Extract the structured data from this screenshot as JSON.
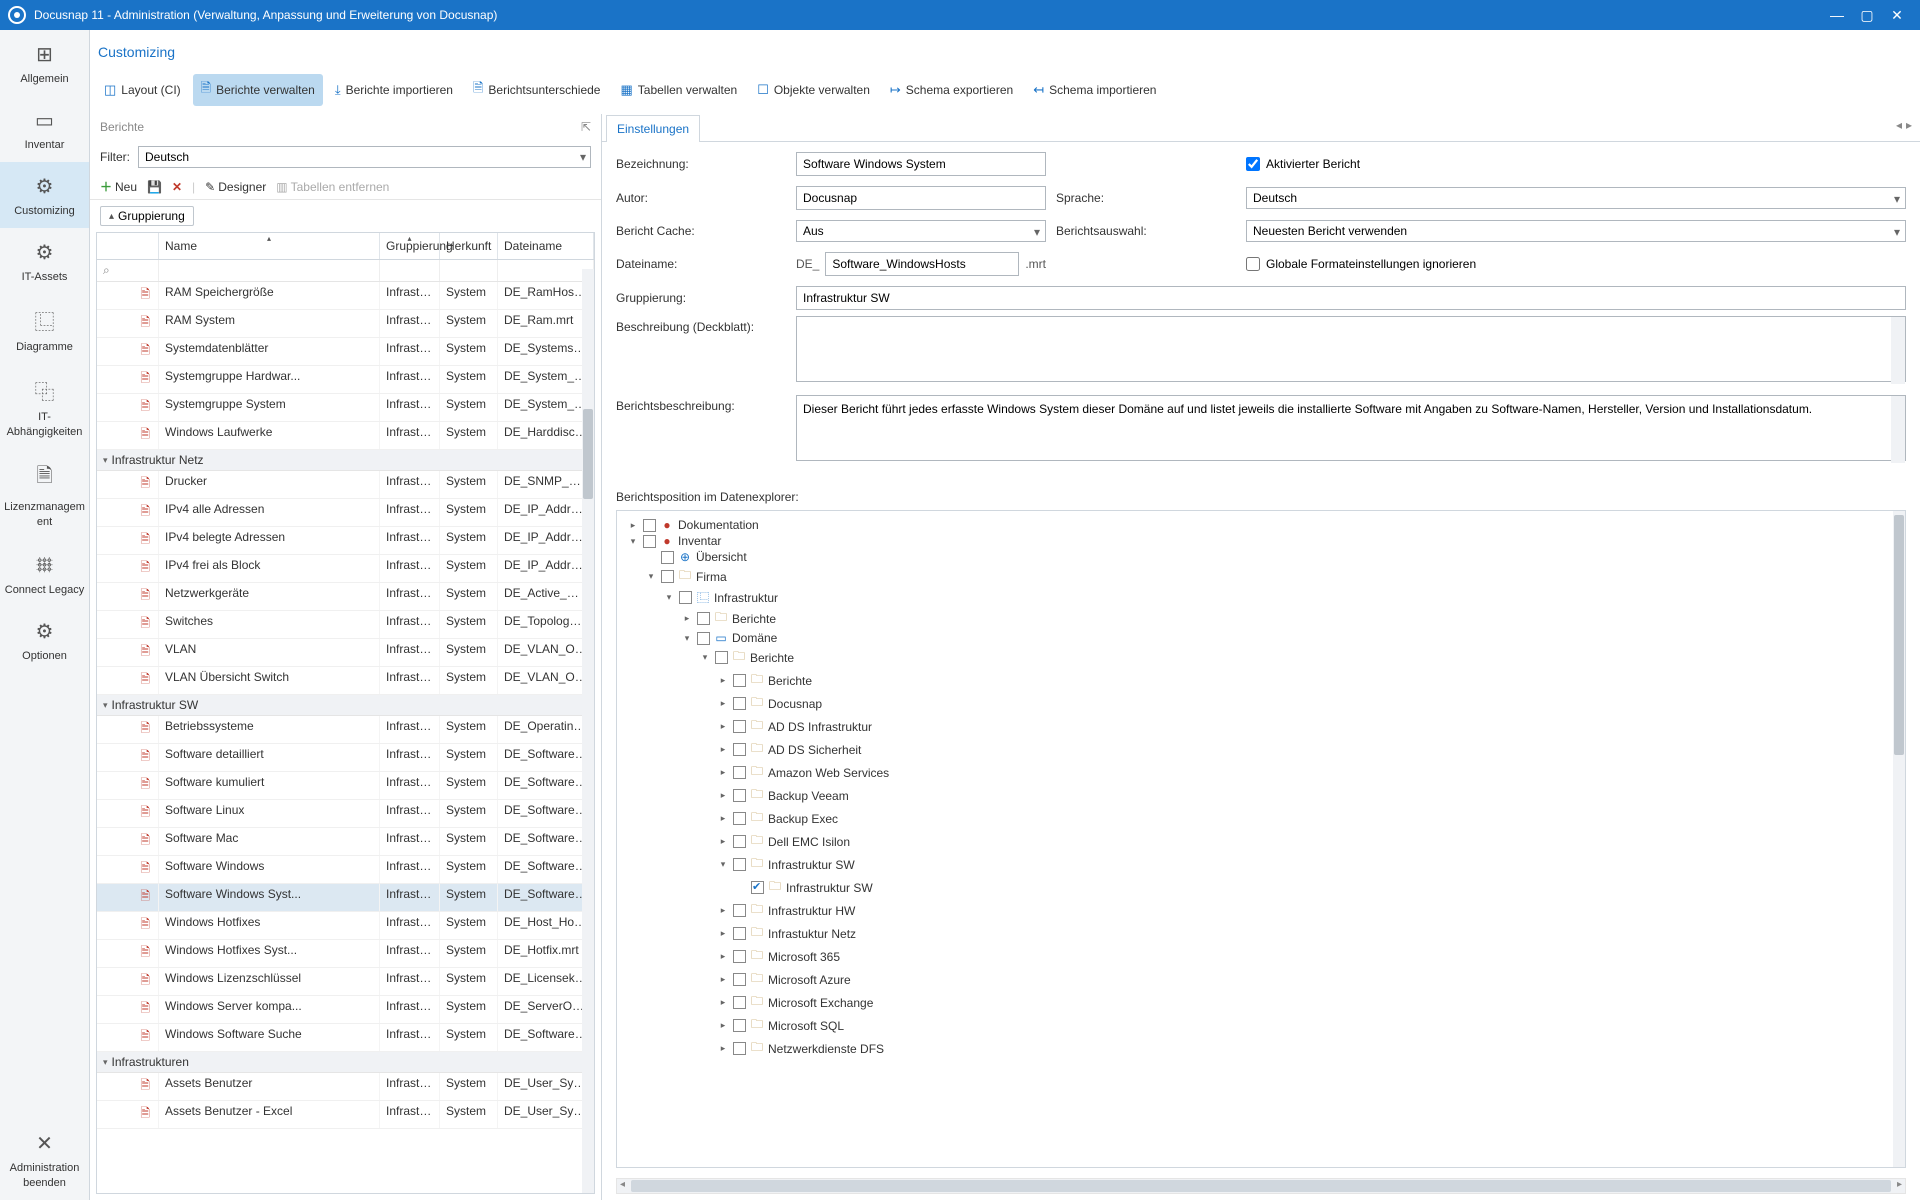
{
  "titlebar": {
    "text": "Docusnap 11 - Administration (Verwaltung, Anpassung und Erweiterung von Docusnap)"
  },
  "sidebar": {
    "items": [
      {
        "label": "Allgemein",
        "icon": "⊞"
      },
      {
        "label": "Inventar",
        "icon": "▭"
      },
      {
        "label": "Customizing",
        "icon": "⚙"
      },
      {
        "label": "IT-Assets",
        "icon": "⚙"
      },
      {
        "label": "Diagramme",
        "icon": "⿺"
      },
      {
        "label": "IT-Abhängigkeiten",
        "icon": "⿻"
      },
      {
        "label": "Lizenzmanagement",
        "icon": "🗎"
      },
      {
        "label": "Connect Legacy",
        "icon": "𐄳"
      },
      {
        "label": "Optionen",
        "icon": "⚙"
      }
    ],
    "exit": {
      "label": "Administration beenden",
      "icon": "✕"
    }
  },
  "page": {
    "title": "Customizing"
  },
  "toolbar": {
    "items": [
      {
        "label": "Layout (CI)",
        "icon": "◫"
      },
      {
        "label": "Berichte verwalten",
        "icon": "🗎"
      },
      {
        "label": "Berichte importieren",
        "icon": "⤓"
      },
      {
        "label": "Berichtsunterschiede",
        "icon": "🗎"
      },
      {
        "label": "Tabellen verwalten",
        "icon": "▦"
      },
      {
        "label": "Objekte verwalten",
        "icon": "☐"
      },
      {
        "label": "Schema exportieren",
        "icon": "↦"
      },
      {
        "label": "Schema importieren",
        "icon": "↤"
      }
    ]
  },
  "leftPane": {
    "header": "Berichte",
    "filter_label": "Filter:",
    "filter_value": "Deutsch",
    "actions": {
      "neu": "Neu",
      "designer": "Designer",
      "remove": "Tabellen entfernen"
    },
    "group_chip": "Gruppierung",
    "columns": {
      "name": "Name",
      "grp": "Gruppierung",
      "her": "Herkunft",
      "file": "Dateiname"
    },
    "groups": [
      {
        "name": "",
        "rows": [
          {
            "name": "RAM Speichergröße",
            "grp": "Infrastruk...",
            "her": "System",
            "file": "DE_RamHosts.mrt"
          },
          {
            "name": "RAM System",
            "grp": "Infrastruk...",
            "her": "System",
            "file": "DE_Ram.mrt"
          },
          {
            "name": "Systemdatenblätter",
            "grp": "Infrastruk...",
            "her": "System",
            "file": "DE_Systems_Ov..."
          },
          {
            "name": "Systemgruppe Hardwar...",
            "grp": "Infrastruk...",
            "her": "System",
            "file": "DE_System_Gro..."
          },
          {
            "name": "Systemgruppe System",
            "grp": "Infrastruk...",
            "her": "System",
            "file": "DE_System_Gro..."
          },
          {
            "name": "Windows Laufwerke",
            "grp": "Infrastruk...",
            "her": "System",
            "file": "DE_Harddisc.mrt"
          }
        ]
      },
      {
        "name": "Infrastruktur Netz",
        "rows": [
          {
            "name": "Drucker",
            "grp": "Infrastruk...",
            "her": "System",
            "file": "DE_SNMP_Netw..."
          },
          {
            "name": "IPv4 alle Adressen",
            "grp": "Infrastruk...",
            "her": "System",
            "file": "DE_IP_Addresses..."
          },
          {
            "name": "IPv4 belegte Adressen",
            "grp": "Infrastruk...",
            "her": "System",
            "file": "DE_IP_Addresses..."
          },
          {
            "name": "IPv4 frei als Block",
            "grp": "Infrastruk...",
            "her": "System",
            "file": "DE_IP_Addresses..."
          },
          {
            "name": "Netzwerkgeräte",
            "grp": "Infrastruk...",
            "her": "System",
            "file": "DE_Active_Netw..."
          },
          {
            "name": "Switches",
            "grp": "Infrastruk...",
            "her": "System",
            "file": "DE_Topology_Inf..."
          },
          {
            "name": "VLAN",
            "grp": "Infrastruk...",
            "her": "System",
            "file": "DE_VLAN_Overv..."
          },
          {
            "name": "VLAN Übersicht Switch",
            "grp": "Infrastruk...",
            "her": "System",
            "file": "DE_VLAN_Overv..."
          }
        ]
      },
      {
        "name": "Infrastruktur SW",
        "rows": [
          {
            "name": "Betriebssysteme",
            "grp": "Infrastruk...",
            "her": "System",
            "file": "DE_Operating_S..."
          },
          {
            "name": "Software detailliert",
            "grp": "Infrastruk...",
            "her": "System",
            "file": "DE_Software_Su..."
          },
          {
            "name": "Software kumuliert",
            "grp": "Infrastruk...",
            "her": "System",
            "file": "DE_Software_Su..."
          },
          {
            "name": "Software Linux",
            "grp": "Infrastruk...",
            "her": "System",
            "file": "DE_Software_Lin..."
          },
          {
            "name": "Software Mac",
            "grp": "Infrastruk...",
            "her": "System",
            "file": "DE_Software_Ma..."
          },
          {
            "name": "Software Windows",
            "grp": "Infrastruk...",
            "her": "System",
            "file": "DE_Software_Wi..."
          },
          {
            "name": "Software Windows Syst...",
            "grp": "Infrastruk...",
            "her": "System",
            "file": "DE_Software_Wi...",
            "selected": true
          },
          {
            "name": "Windows Hotfixes",
            "grp": "Infrastruk...",
            "her": "System",
            "file": "DE_Host_Hotfix..."
          },
          {
            "name": "Windows Hotfixes Syst...",
            "grp": "Infrastruk...",
            "her": "System",
            "file": "DE_Hotfix.mrt"
          },
          {
            "name": "Windows Lizenzschlüssel",
            "grp": "Infrastruk...",
            "her": "System",
            "file": "DE_Licensekey.mrt"
          },
          {
            "name": "Windows Server kompa...",
            "grp": "Infrastruk...",
            "her": "System",
            "file": "DE_ServerOvervi..."
          },
          {
            "name": "Windows Software Suche",
            "grp": "Infrastruk...",
            "her": "System",
            "file": "DE_Software_Sea..."
          }
        ]
      },
      {
        "name": "Infrastrukturen",
        "rows": [
          {
            "name": "Assets Benutzer",
            "grp": "Infrastruk...",
            "her": "System",
            "file": "DE_User_System..."
          },
          {
            "name": "Assets Benutzer - Excel",
            "grp": "Infrastruk...",
            "her": "System",
            "file": "DE_User_System..."
          }
        ]
      }
    ]
  },
  "settings": {
    "tab": "Einstellungen",
    "labels": {
      "bezeichnung": "Bezeichnung:",
      "aktiv": "Aktivierter Bericht",
      "autor": "Autor:",
      "sprache": "Sprache:",
      "cache": "Bericht Cache:",
      "auswahl": "Berichtsauswahl:",
      "dateiname": "Dateiname:",
      "globale": "Globale Formateinstellungen ignorieren",
      "gruppierung": "Gruppierung:",
      "deckblatt": "Beschreibung (Deckblatt):",
      "beschreibung": "Berichtsbeschreibung:",
      "position": "Berichtsposition im Datenexplorer:"
    },
    "values": {
      "bezeichnung": "Software Windows System",
      "aktiv": true,
      "autor": "Docusnap",
      "sprache": "Deutsch",
      "cache": "Aus",
      "auswahl": "Neuesten Bericht verwenden",
      "dateiname_prefix": "DE_",
      "dateiname": "Software_WindowsHosts",
      "dateiname_suffix": ".mrt",
      "globale": false,
      "gruppierung": "Infrastruktur SW",
      "deckblatt": "",
      "beschreibung": "Dieser Bericht führt jedes erfasste Windows System dieser Domäne auf und listet jeweils die installierte Software mit Angaben zu Software-Namen, Hersteller, Version und Installationsdatum."
    }
  },
  "tree": [
    {
      "d": 0,
      "tog": "▸",
      "cb": true,
      "icon": "●",
      "ic": "red",
      "label": "Dokumentation"
    },
    {
      "d": 0,
      "tog": "▾",
      "cb": true,
      "icon": "●",
      "ic": "red",
      "label": "Inventar"
    },
    {
      "d": 1,
      "tog": "",
      "cb": true,
      "icon": "⊕",
      "ic": "blue",
      "label": "Übersicht"
    },
    {
      "d": 1,
      "tog": "▾",
      "cb": true,
      "icon": "🗀",
      "ic": "",
      "label": "Firma"
    },
    {
      "d": 2,
      "tog": "▾",
      "cb": true,
      "icon": "⿺",
      "ic": "blue",
      "label": "Infrastruktur"
    },
    {
      "d": 3,
      "tog": "▸",
      "cb": true,
      "icon": "🗀",
      "ic": "",
      "label": "Berichte"
    },
    {
      "d": 3,
      "tog": "▾",
      "cb": true,
      "icon": "▭",
      "ic": "blue",
      "label": "Domäne"
    },
    {
      "d": 4,
      "tog": "▾",
      "cb": true,
      "icon": "🗀",
      "ic": "",
      "label": "Berichte"
    },
    {
      "d": 5,
      "tog": "▸",
      "cb": true,
      "icon": "🗀",
      "ic": "",
      "label": "Berichte"
    },
    {
      "d": 5,
      "tog": "▸",
      "cb": true,
      "icon": "🗀",
      "ic": "",
      "label": "Docusnap"
    },
    {
      "d": 5,
      "tog": "▸",
      "cb": true,
      "icon": "🗀",
      "ic": "",
      "label": "AD DS Infrastruktur"
    },
    {
      "d": 5,
      "tog": "▸",
      "cb": true,
      "icon": "🗀",
      "ic": "",
      "label": "AD DS Sicherheit"
    },
    {
      "d": 5,
      "tog": "▸",
      "cb": true,
      "icon": "🗀",
      "ic": "",
      "label": "Amazon Web Services"
    },
    {
      "d": 5,
      "tog": "▸",
      "cb": true,
      "icon": "🗀",
      "ic": "",
      "label": "Backup Veeam"
    },
    {
      "d": 5,
      "tog": "▸",
      "cb": true,
      "icon": "🗀",
      "ic": "",
      "label": "Backup Exec"
    },
    {
      "d": 5,
      "tog": "▸",
      "cb": true,
      "icon": "🗀",
      "ic": "",
      "label": "Dell EMC Isilon"
    },
    {
      "d": 5,
      "tog": "▾",
      "cb": true,
      "icon": "🗀",
      "ic": "",
      "label": "Infrastruktur SW"
    },
    {
      "d": 6,
      "tog": "",
      "cb": true,
      "checked": true,
      "icon": "🗀",
      "ic": "",
      "label": "Infrastruktur SW"
    },
    {
      "d": 5,
      "tog": "▸",
      "cb": true,
      "icon": "🗀",
      "ic": "",
      "label": "Infrastruktur HW"
    },
    {
      "d": 5,
      "tog": "▸",
      "cb": true,
      "icon": "🗀",
      "ic": "",
      "label": "Infrastuktur Netz"
    },
    {
      "d": 5,
      "tog": "▸",
      "cb": true,
      "icon": "🗀",
      "ic": "",
      "label": "Microsoft 365"
    },
    {
      "d": 5,
      "tog": "▸",
      "cb": true,
      "icon": "🗀",
      "ic": "",
      "label": "Microsoft Azure"
    },
    {
      "d": 5,
      "tog": "▸",
      "cb": true,
      "icon": "🗀",
      "ic": "",
      "label": "Microsoft Exchange"
    },
    {
      "d": 5,
      "tog": "▸",
      "cb": true,
      "icon": "🗀",
      "ic": "",
      "label": "Microsoft SQL"
    },
    {
      "d": 5,
      "tog": "▸",
      "cb": true,
      "icon": "🗀",
      "ic": "",
      "label": "Netzwerkdienste DFS"
    }
  ]
}
